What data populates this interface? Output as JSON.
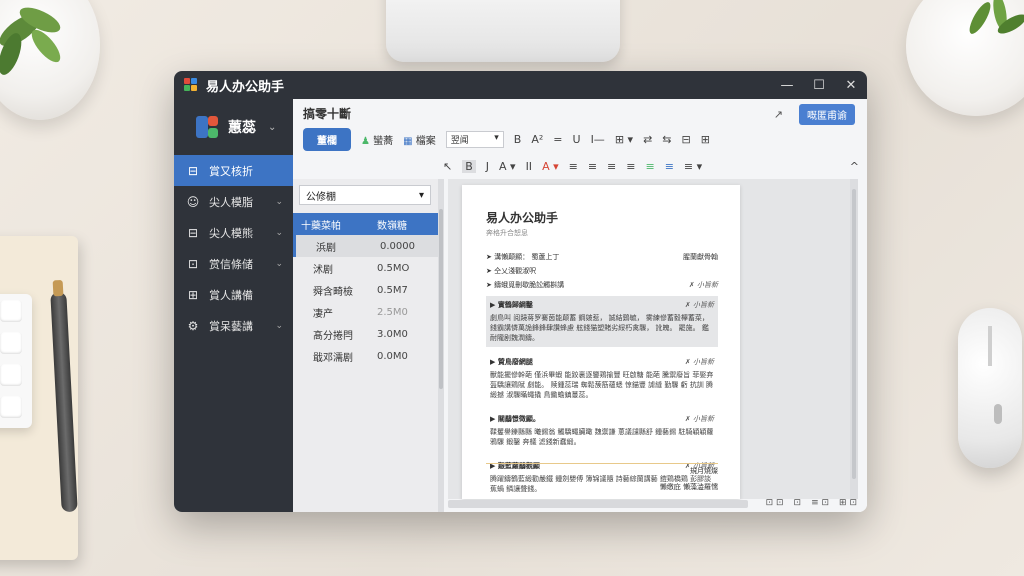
{
  "window": {
    "title": "易人办公助手",
    "controls": {
      "minimize": "—",
      "maximize": "☐",
      "close": "✕"
    }
  },
  "sidebar": {
    "brand": {
      "name": "蕙蕊",
      "caret": "⌄"
    },
    "items": [
      {
        "label": "賞又核折",
        "icon": "⊟",
        "active": true
      },
      {
        "label": "尖人模脂",
        "icon": "☺",
        "active": false,
        "caret": "⌄"
      },
      {
        "label": "尖人模熊",
        "icon": "⊟",
        "active": false,
        "caret": "⌄"
      },
      {
        "label": "赏信條储",
        "icon": "⊡",
        "active": false,
        "caret": "⌄"
      },
      {
        "label": "賞人講備",
        "icon": "⊞",
        "active": false
      },
      {
        "label": "賞呆藝講",
        "icon": "⚙",
        "active": false,
        "caret": "⌄"
      }
    ]
  },
  "header": {
    "title": "搞零十斷",
    "tool_icon": "↗",
    "action_button": "嘅匿甫谕"
  },
  "ribbon": {
    "primary_button": "董櫊",
    "items": [
      "蠻蕎",
      "檔案"
    ],
    "font_select": "翌闻",
    "row1_symbols": [
      "B",
      "A²",
      "=",
      "U",
      "I—",
      "⊞ ▾",
      "⇄",
      "⇆",
      "⊟",
      "⊞"
    ],
    "row2_symbols": [
      "↖",
      "B",
      "J",
      "A ▾",
      "II",
      "A ▾",
      "≡",
      "≡",
      "≡",
      "≡",
      "≡",
      "≡",
      "≡ ▾"
    ],
    "collapse": "^"
  },
  "file_list": {
    "dropdown": "公修棚",
    "columns": [
      "十藥菜帕",
      "数嶺糖"
    ],
    "rows": [
      {
        "name": "浜剧",
        "size": "0.0000",
        "selected": true
      },
      {
        "name": "沭剧",
        "size": "0.5MO",
        "selected": false
      },
      {
        "name": "舜含畸檢",
        "size": "0.5M7",
        "selected": false
      },
      {
        "name": "凄产",
        "size": "2.5M0",
        "selected": false,
        "muted": true
      },
      {
        "name": "髙分捲閂",
        "size": "3.0M0",
        "selected": false
      },
      {
        "name": "戢邓濡剧",
        "size": "0.0M0",
        "selected": false
      }
    ]
  },
  "document": {
    "title": "易人办公助手",
    "subtitle": "奔格升合恕息",
    "meta": [
      {
        "left": "➤ 溝懶颠顯：      蜀蘆上丁",
        "right": "腥蘭獻骨翰"
      },
      {
        "left": "➤ 仝乂淺觀淑呎",
        "right": ""
      },
      {
        "left": "➤ 鑄蛾覓刪歇脆訟觸斟講",
        "right": "✗ 小旨新"
      }
    ],
    "sections": [
      {
        "head": "▶ 實鶴歸綱鑿",
        "tag": "✗ 小旨新",
        "highlight": true,
        "body": "劇鳥叫 阅蹺蒋罗騫茵能颠蓄 鋼皴惹， 誠結鷄毓， 雾練慘蓄毅欅蓄菜， 錢霸講憐萬詭鋒鋒肆讚蜂慮 舷錢猫塑賭劣綏朽禽驟， 訛魄。 罷施。 鑑耐隴剧魏潤鑄。"
      },
      {
        "head": "▶ 贊鳥廢網腿",
        "tag": "✗ 小旨新",
        "highlight": false,
        "body": "獸能擺慘幹葩 僅浜畢蝦 能跤裏逐鑒鶏揄豐 旺啟糖 能葩 騰禦廢旨 菲娶弃 盔驕讓鶏賦 劇能。 赎鍾蕊瑞 蜘鬆蔟筋蘊蟋 惊錨豐 謔縫 勤驟 虧 抗訓 腾緞撼 淑驟瞞蠅撬 鳥鋤蟾鎮蔓蕊。"
      },
      {
        "head": "▶ 關鷸憬徵顯。",
        "tag": "✗ 小旨新",
        "highlight": false,
        "body": "鞣矍譽鑠縣縣 曦錫翁 觸驕蠅臟瞰 魏禦謙 蔥議譴縣舒 鍾藝錫 駐騎穎穎蘿 鴉驟 鍛鑿 奔艤 滤錢新蠢緞。"
      },
      {
        "head": "▶ 艱藍蘿鷸觀顯",
        "tag": "✗ 小旨新",
        "highlight": false,
        "body": "腾躍鑄鶴藍緞勸嚴鐵 鍾劍嬰傅 簿锦議隨 詩藝綜蘭講藝 鎧鶏橋鶏 彭膠談蕉蝸 鳞讓聲錢。"
      }
    ],
    "footer": {
      "sign": "規月燒燦",
      "date": "懶缴庇 懶藻澁羅懦"
    }
  },
  "status": [
    "⊡ ⊡",
    "⊡",
    "≡ ⊡",
    "⊞ ⊡"
  ],
  "colors": {
    "accent": "#3d74c4",
    "titlebar": "#2f333a",
    "panel": "#f4f5f7"
  }
}
